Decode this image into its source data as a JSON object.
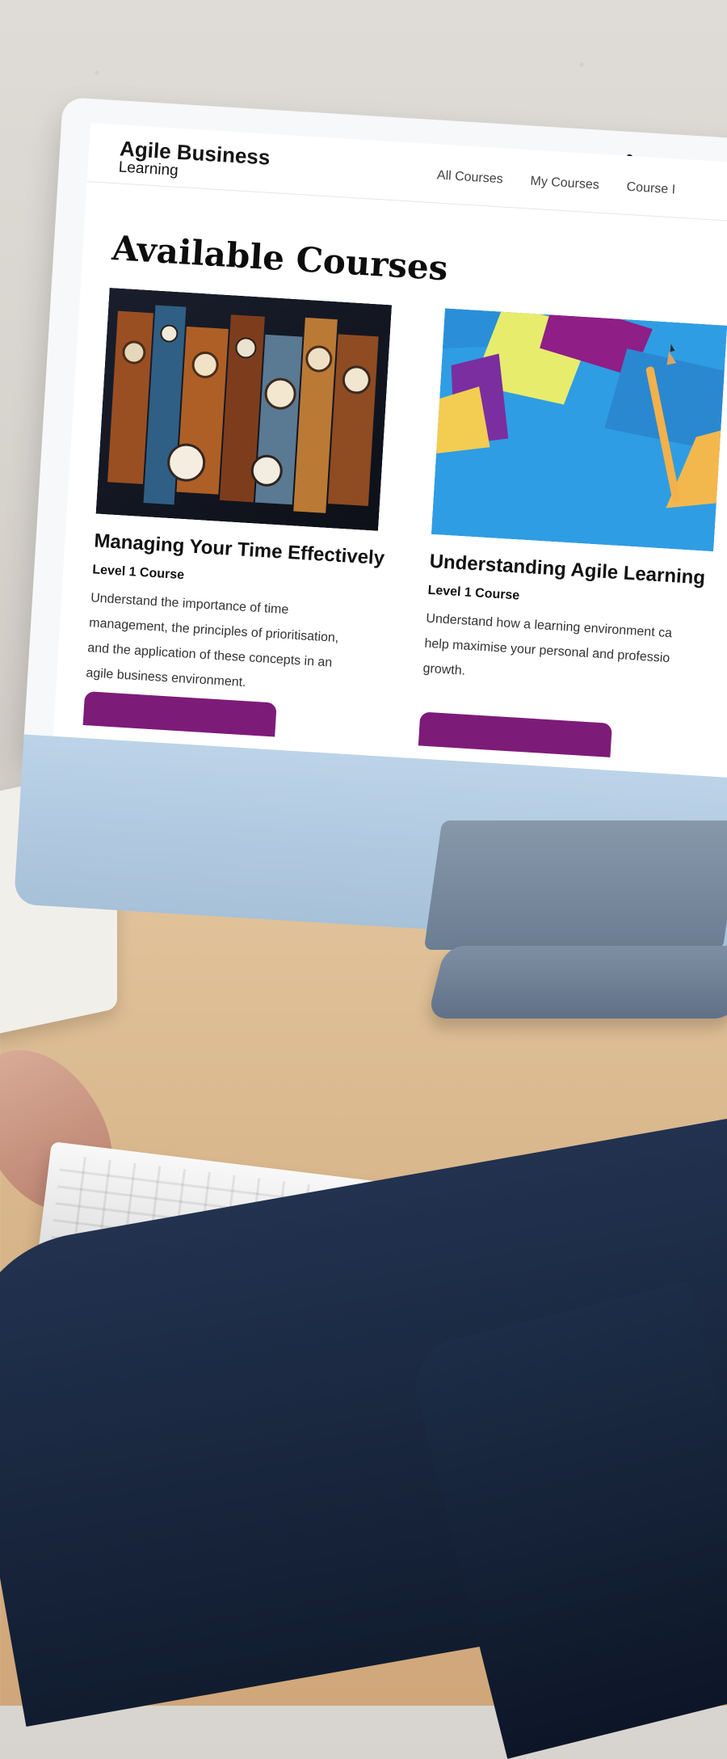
{
  "brand": {
    "title": "Agile Business",
    "subtitle": "Learning"
  },
  "nav": {
    "items": [
      "All Courses",
      "My Courses",
      "Course I"
    ]
  },
  "page": {
    "title": "Available Courses"
  },
  "courses": [
    {
      "title": "Managing Your Time Effectively",
      "level": "Level 1 Course",
      "description": "Understand the importance of time management, the principles of prioritisation, and the application of these concepts in an agile business environment.",
      "image": "clocks-image"
    },
    {
      "title": "Understanding Agile Learning",
      "level": "Level 1 Course",
      "description": "Understand how a learning environment ca help maximise your personal and professio growth.",
      "image": "sticky-notes-image"
    }
  ],
  "colors": {
    "accent": "#7d1b79"
  }
}
